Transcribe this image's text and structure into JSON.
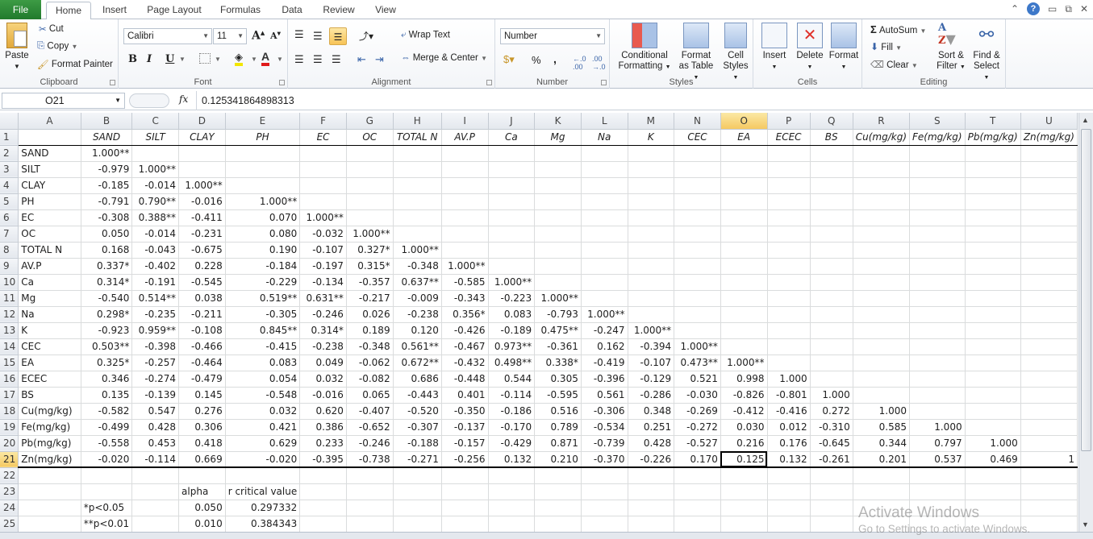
{
  "ribbon_tabs": [
    "File",
    "Home",
    "Insert",
    "Page Layout",
    "Formulas",
    "Data",
    "Review",
    "View"
  ],
  "active_tab": "Home",
  "clipboard": {
    "paste": "Paste",
    "cut": "Cut",
    "copy": "Copy",
    "format_painter": "Format Painter",
    "label": "Clipboard"
  },
  "font": {
    "name": "Calibri",
    "size": "11",
    "bold": "B",
    "italic": "I",
    "underline": "U",
    "label": "Font"
  },
  "alignment": {
    "wrap_text": "Wrap Text",
    "merge_center": "Merge & Center",
    "label": "Alignment"
  },
  "number": {
    "format": "Number",
    "percent": "%",
    "comma": ",",
    "inc_dec": ".0→.00",
    "dec_dec": ".00→.0",
    "label": "Number"
  },
  "styles": {
    "conditional": "Conditional",
    "conditional2": "Formatting",
    "format_table": "Format",
    "format_table2": "as Table",
    "cell_styles": "Cell",
    "cell_styles2": "Styles",
    "label": "Styles"
  },
  "cells": {
    "insert": "Insert",
    "delete": "Delete",
    "format": "Format",
    "label": "Cells"
  },
  "editing": {
    "autosum": "AutoSum",
    "fill": "Fill",
    "clear": "Clear",
    "sort": "Sort &",
    "sort2": "Filter",
    "find": "Find &",
    "find2": "Select",
    "label": "Editing"
  },
  "formula_bar": {
    "name_box": "O21",
    "fx": "fx",
    "formula": "0.125341864898313"
  },
  "columns": [
    "A",
    "B",
    "C",
    "D",
    "E",
    "F",
    "G",
    "H",
    "I",
    "J",
    "K",
    "L",
    "M",
    "N",
    "O",
    "P",
    "Q",
    "R",
    "S",
    "T",
    "U"
  ],
  "selected_column": "O",
  "selected_row": "21",
  "header_row": [
    "",
    "SAND",
    "SILT",
    "CLAY",
    "PH",
    "EC",
    "OC",
    "TOTAL N",
    "AV.P",
    "Ca",
    "Mg",
    "Na",
    "K",
    "CEC",
    "EA",
    "ECEC",
    "BS",
    "Cu(mg/kg)",
    "Fe(mg/kg)",
    "Pb(mg/kg)",
    "Zn(mg/kg)"
  ],
  "rows": [
    {
      "n": "2",
      "label": "SAND",
      "values": [
        "1.000**"
      ]
    },
    {
      "n": "3",
      "label": "SILT",
      "values": [
        "-0.979",
        "1.000**"
      ]
    },
    {
      "n": "4",
      "label": "CLAY",
      "values": [
        "-0.185",
        "-0.014",
        "1.000**"
      ]
    },
    {
      "n": "5",
      "label": "PH",
      "values": [
        "-0.791",
        "0.790**",
        "-0.016",
        "1.000**"
      ]
    },
    {
      "n": "6",
      "label": "EC",
      "values": [
        "-0.308",
        "0.388**",
        "-0.411",
        "0.070",
        "1.000**"
      ]
    },
    {
      "n": "7",
      "label": "OC",
      "values": [
        "0.050",
        "-0.014",
        "-0.231",
        "0.080",
        "-0.032",
        "1.000**"
      ]
    },
    {
      "n": "8",
      "label": "TOTAL N",
      "values": [
        "0.168",
        "-0.043",
        "-0.675",
        "0.190",
        "-0.107",
        "0.327*",
        "1.000**"
      ]
    },
    {
      "n": "9",
      "label": "AV.P",
      "values": [
        "0.337*",
        "-0.402",
        "0.228",
        "-0.184",
        "-0.197",
        "0.315*",
        "-0.348",
        "1.000**"
      ]
    },
    {
      "n": "10",
      "label": "Ca",
      "values": [
        "0.314*",
        "-0.191",
        "-0.545",
        "-0.229",
        "-0.134",
        "-0.357",
        "0.637**",
        "-0.585",
        "1.000**"
      ]
    },
    {
      "n": "11",
      "label": "Mg",
      "values": [
        "-0.540",
        "0.514**",
        "0.038",
        "0.519**",
        "0.631**",
        "-0.217",
        "-0.009",
        "-0.343",
        "-0.223",
        "1.000**"
      ]
    },
    {
      "n": "12",
      "label": "Na",
      "values": [
        "0.298*",
        "-0.235",
        "-0.211",
        "-0.305",
        "-0.246",
        "0.026",
        "-0.238",
        "0.356*",
        "0.083",
        "-0.793",
        "1.000**"
      ]
    },
    {
      "n": "13",
      "label": "K",
      "values": [
        "-0.923",
        "0.959**",
        "-0.108",
        "0.845**",
        "0.314*",
        "0.189",
        "0.120",
        "-0.426",
        "-0.189",
        "0.475**",
        "-0.247",
        "1.000**"
      ]
    },
    {
      "n": "14",
      "label": "CEC",
      "values": [
        "0.503**",
        "-0.398",
        "-0.466",
        "-0.415",
        "-0.238",
        "-0.348",
        "0.561**",
        "-0.467",
        "0.973**",
        "-0.361",
        "0.162",
        "-0.394",
        "1.000**"
      ]
    },
    {
      "n": "15",
      "label": "EA",
      "values": [
        "0.325*",
        "-0.257",
        "-0.464",
        "0.083",
        "0.049",
        "-0.062",
        "0.672**",
        "-0.432",
        "0.498**",
        "0.338*",
        "-0.419",
        "-0.107",
        "0.473**",
        "1.000**"
      ]
    },
    {
      "n": "16",
      "label": "ECEC",
      "values": [
        "0.346",
        "-0.274",
        "-0.479",
        "0.054",
        "0.032",
        "-0.082",
        "0.686",
        "-0.448",
        "0.544",
        "0.305",
        "-0.396",
        "-0.129",
        "0.521",
        "0.998",
        "1.000"
      ]
    },
    {
      "n": "17",
      "label": "BS",
      "values": [
        "0.135",
        "-0.139",
        "0.145",
        "-0.548",
        "-0.016",
        "0.065",
        "-0.443",
        "0.401",
        "-0.114",
        "-0.595",
        "0.561",
        "-0.286",
        "-0.030",
        "-0.826",
        "-0.801",
        "1.000"
      ]
    },
    {
      "n": "18",
      "label": "Cu(mg/kg)",
      "values": [
        "-0.582",
        "0.547",
        "0.276",
        "0.032",
        "0.620",
        "-0.407",
        "-0.520",
        "-0.350",
        "-0.186",
        "0.516",
        "-0.306",
        "0.348",
        "-0.269",
        "-0.412",
        "-0.416",
        "0.272",
        "1.000"
      ]
    },
    {
      "n": "19",
      "label": "Fe(mg/kg)",
      "values": [
        "-0.499",
        "0.428",
        "0.306",
        "0.421",
        "0.386",
        "-0.652",
        "-0.307",
        "-0.137",
        "-0.170",
        "0.789",
        "-0.534",
        "0.251",
        "-0.272",
        "0.030",
        "0.012",
        "-0.310",
        "0.585",
        "1.000"
      ]
    },
    {
      "n": "20",
      "label": "Pb(mg/kg)",
      "values": [
        "-0.558",
        "0.453",
        "0.418",
        "0.629",
        "0.233",
        "-0.246",
        "-0.188",
        "-0.157",
        "-0.429",
        "0.871",
        "-0.739",
        "0.428",
        "-0.527",
        "0.216",
        "0.176",
        "-0.645",
        "0.344",
        "0.797",
        "1.000"
      ]
    },
    {
      "n": "21",
      "label": "Zn(mg/kg)",
      "values": [
        "-0.020",
        "-0.114",
        "0.669",
        "-0.020",
        "-0.395",
        "-0.738",
        "-0.271",
        "-0.256",
        "0.132",
        "0.210",
        "-0.370",
        "-0.226",
        "0.170",
        "0.125",
        "0.132",
        "-0.261",
        "0.201",
        "0.537",
        "0.469",
        "1"
      ]
    }
  ],
  "footer_rows": [
    {
      "n": "22",
      "cells": {}
    },
    {
      "n": "23",
      "cells": {
        "D": "alpha",
        "E": "r critical value"
      }
    },
    {
      "n": "24",
      "cells": {
        "B": "*p<0.05",
        "D": "0.050",
        "E": "0.297332"
      }
    },
    {
      "n": "25",
      "cells": {
        "B": "**p<0.01",
        "D": "0.010",
        "E": "0.384343"
      }
    }
  ],
  "watermark": {
    "line1": "Activate Windows",
    "line2": "Go to Settings to activate Windows."
  }
}
